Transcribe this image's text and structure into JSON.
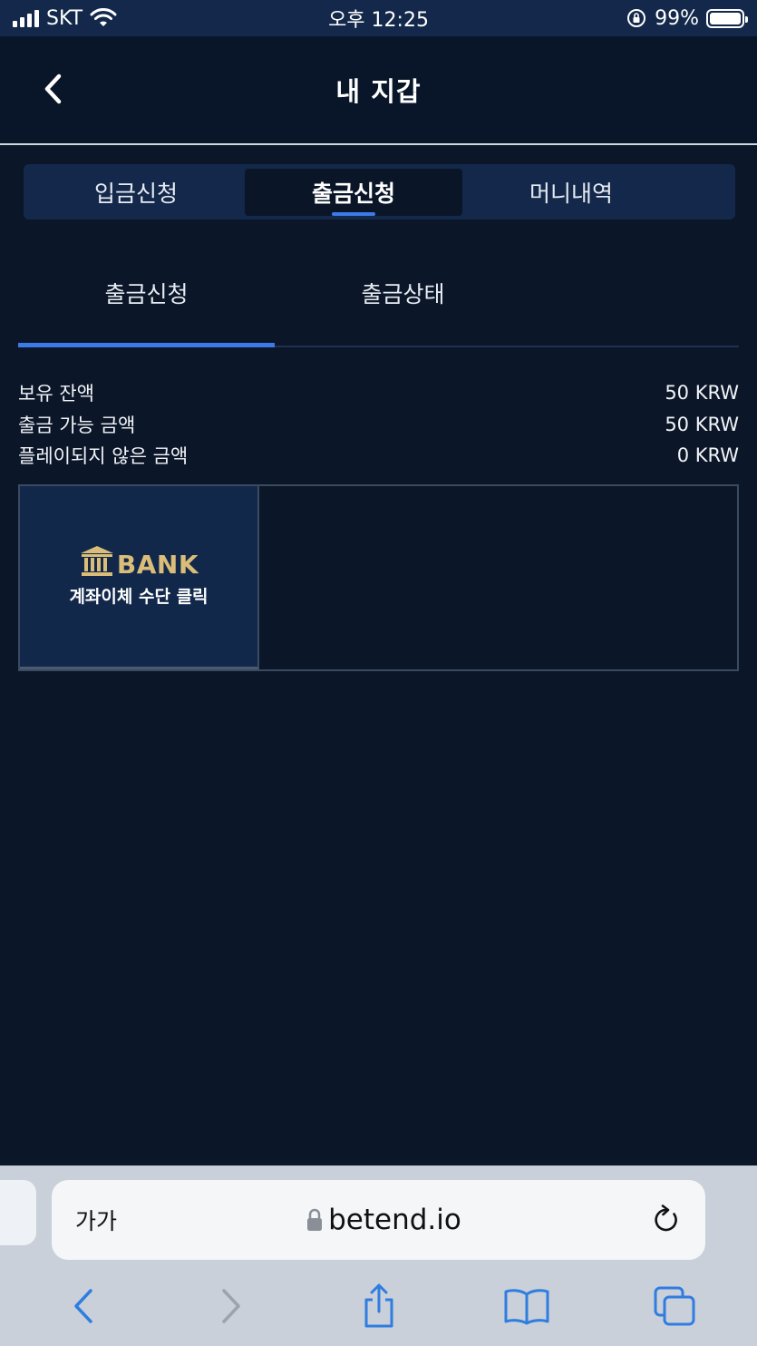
{
  "status_bar": {
    "carrier": "SKT",
    "time": "오후 12:25",
    "battery": "99%"
  },
  "header": {
    "title": "내 지갑"
  },
  "main_tabs": [
    {
      "label": "입금신청",
      "active": false
    },
    {
      "label": "출금신청",
      "active": true
    },
    {
      "label": "머니내역",
      "active": false
    }
  ],
  "sub_tabs": [
    {
      "label": "출금신청",
      "active": true
    },
    {
      "label": "출금상태",
      "active": false
    }
  ],
  "balances": [
    {
      "label": "보유 잔액",
      "value": "50 KRW"
    },
    {
      "label": "출금 가능 금액",
      "value": "50 KRW"
    },
    {
      "label": "플레이되지 않은 금액",
      "value": "0 KRW"
    }
  ],
  "payment": {
    "bank_word": "BANK",
    "caption": "계좌이체 수단 클릭"
  },
  "browser": {
    "text_size": "가가",
    "url": "betend.io"
  },
  "colors": {
    "accent": "#3b7ae8",
    "gold": "#d9bd78",
    "background": "#0b1628",
    "tab_bar": "#13284a"
  }
}
